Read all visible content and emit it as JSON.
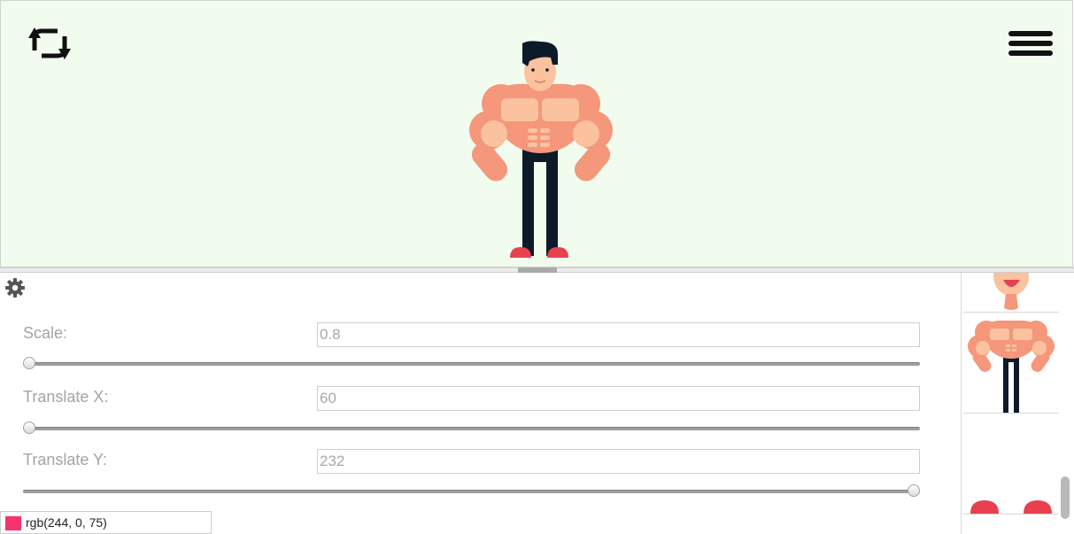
{
  "toolbar": {
    "refresh_icon": "refresh-cycle-icon",
    "menu_icon": "hamburger-menu-icon"
  },
  "settings": {
    "gear_icon": "gear-icon",
    "scale": {
      "label": "Scale:",
      "value": "0.8",
      "slider_fraction": 0.0
    },
    "translate_x": {
      "label": "Translate X:",
      "value": "60",
      "slider_fraction": 0.0
    },
    "translate_y": {
      "label": "Translate Y:",
      "value": "232",
      "slider_fraction": 1.0
    }
  },
  "color": {
    "text": "rgb(244, 0, 75)",
    "swatch": "#f4004b"
  },
  "colors": {
    "canvas_bg": "#f1fcee",
    "skin": "#f4977b",
    "skin_light": "#fac29f",
    "hair": "#0c1a2a",
    "shoe": "#e8404f"
  },
  "parts": [
    "head",
    "body",
    "shoes"
  ]
}
